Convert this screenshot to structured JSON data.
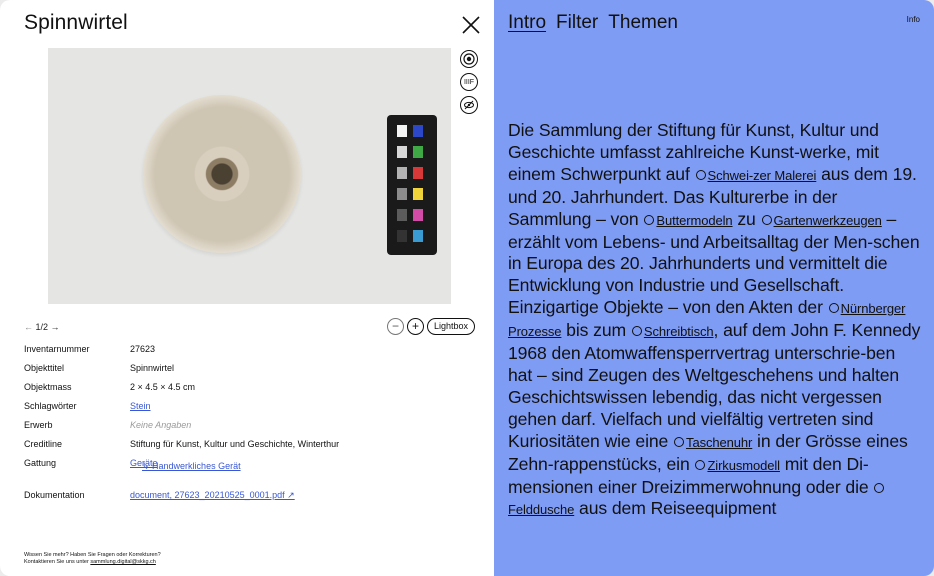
{
  "detail": {
    "title": "Spinnwirtel",
    "close_icon": "close-icon",
    "side_icons": [
      "target-icon",
      "iiif-icon",
      "eye-off-icon"
    ],
    "iiif_label": "IIIF",
    "pager": {
      "prev": "←",
      "current": "1/2",
      "next": "→"
    },
    "controls": {
      "minus": "−",
      "plus": "+",
      "lightbox": "Lightbox"
    },
    "fields": [
      {
        "label": "Inventarnummer",
        "value": "27623"
      },
      {
        "label": "Objekttitel",
        "value": "Spinnwirtel"
      },
      {
        "label": "Objektmass",
        "value": "2 × 4.5 × 4.5 cm"
      },
      {
        "label": "Schlagwörter",
        "value": "Stein"
      },
      {
        "label": "Erwerb",
        "value": "Keine Angaben"
      },
      {
        "label": "Creditline",
        "value": "Stiftung für Kunst, Kultur und Geschichte, Winterthur"
      },
      {
        "label": "Gattung",
        "value": "Geräte",
        "sub": "↳ Handwerkliches Gerät"
      },
      {
        "label": "Dokumentation",
        "value": "document, 27623_20210525_0001.pdf ↗"
      }
    ],
    "contact_line1": "Wissen Sie mehr? Haben Sie Fragen oder Korrekturen?",
    "contact_line2_prefix": "Kontaktieren Sie uns unter ",
    "contact_email": "sammlung.digital@skkg.ch"
  },
  "nav": {
    "items": [
      "Intro",
      "Filter",
      "Themen"
    ],
    "info": "Info"
  },
  "intro": {
    "t1": "Die Sammlung der Stiftung für Kunst, Kultur und Geschichte umfasst zahlreiche Kunst-werke, mit einem Schwerpunkt auf ",
    "l1": "Schwei-zer Malerei",
    "t2": " aus dem 19. und 20. Jahrhundert. Das Kulturerbe in der Sammlung – von ",
    "l2": "Buttermodeln",
    "t3": " zu ",
    "l3": "Gartenwerkzeugen",
    "t4": " – erzählt vom Lebens- und Arbeitsalltag der Men-schen in Europa des 20. Jahrhunderts und vermittelt die Entwicklung von Industrie und Gesellschaft. Einzigartige Objekte – von den Akten der ",
    "l4": "Nürnberger Prozesse",
    "t5": " bis zum ",
    "l5": "Schreibtisch",
    "t6": ", auf dem John F. Kennedy 1968 den Atomwaffensperrvertrag unterschrie-ben hat – sind Zeugen des Weltgeschehens und halten Geschichtswissen lebendig, das nicht vergessen gehen darf. Vielfach und vielfältig vertreten sind Kuriositäten wie eine ",
    "l6": "Taschenuhr",
    "t7": " in der Grösse eines Zehn-rappenstücks, ein ",
    "l7": "Zirkusmodell",
    "t8": " mit den Di-mensionen einer Dreizimmerwohnung oder die ",
    "l8": "Felddusche",
    "t9": " aus dem Reiseequipment"
  },
  "colors": {
    "accent_panel": "#7f9cf5",
    "link": "#3957d3"
  }
}
